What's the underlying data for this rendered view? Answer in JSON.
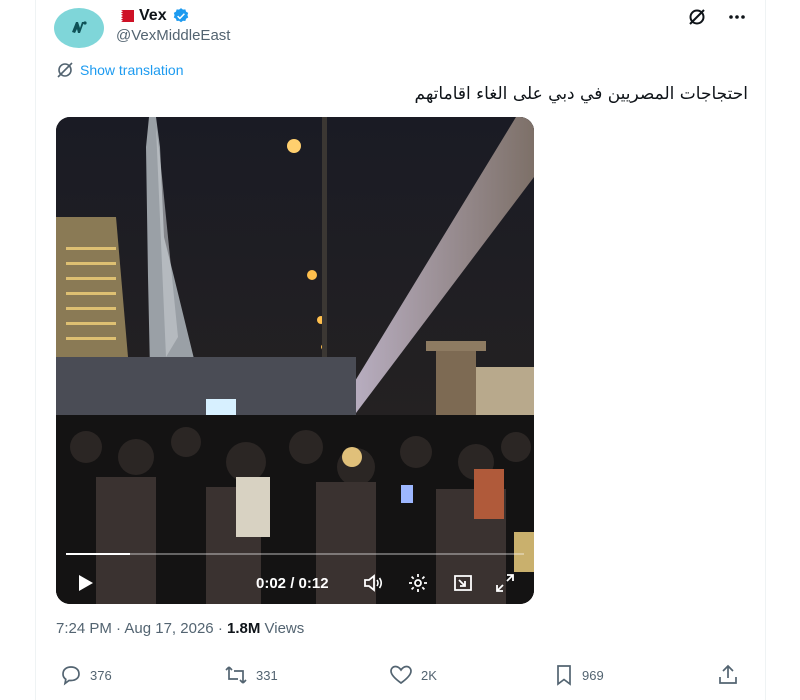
{
  "tweet": {
    "author_name": "Vex",
    "handle": "@VexMiddleEast",
    "translation_label": "Show translation",
    "text": "احتجاجات المصريين في دبي على الغاء اقاماتهم"
  },
  "video": {
    "time": "0:02 / 0:12",
    "progress": 0.14
  },
  "meta": {
    "time": "7:24 PM",
    "separator": "·",
    "date": "Aug 17, 2026",
    "views_count": "1.8M",
    "views_label": "Views"
  },
  "actions": {
    "replies": "376",
    "reposts": "331",
    "likes": "2K",
    "bookmarks": "969"
  },
  "colors": {
    "accent": "#1d9bf0",
    "muted": "#536471",
    "avatar_bg": "#7fd6d9"
  },
  "icons": [
    "bahrain-flag-icon",
    "verified-badge-icon",
    "grok-icon",
    "more-icon",
    "translate-icon",
    "play-icon",
    "volume-icon",
    "settings-icon",
    "picture-in-picture-icon",
    "fullscreen-icon",
    "reply-icon",
    "repost-icon",
    "like-icon",
    "bookmark-icon",
    "share-icon"
  ]
}
